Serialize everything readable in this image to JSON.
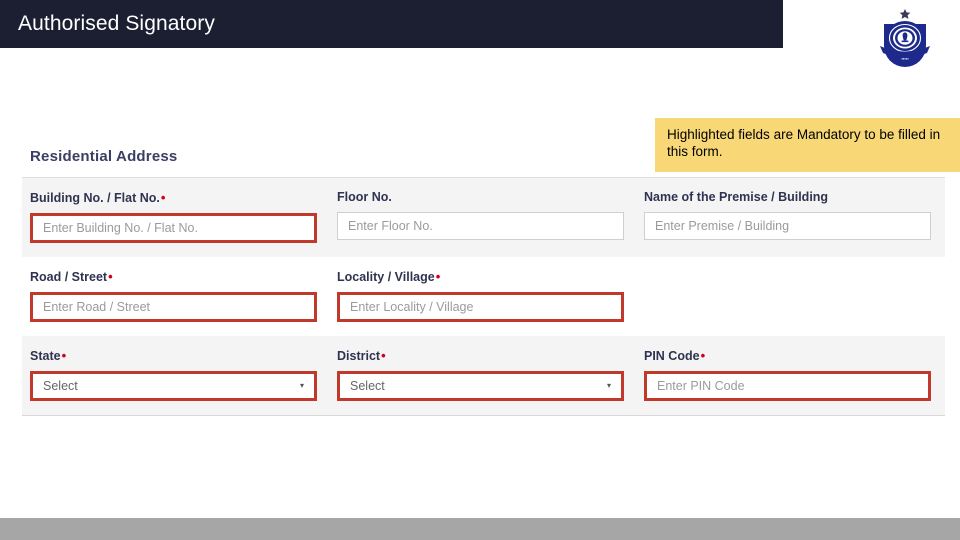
{
  "header": {
    "title": "Authorised Signatory",
    "emblem_label": "government-emblem",
    "background_color": "#1c1f31"
  },
  "callout": {
    "text": "Highlighted fields are Mandatory to be filled in this form.",
    "background_color": "#f8d777"
  },
  "form": {
    "section_title": "Residential Address",
    "required_marker": "•",
    "select_caret": "▾",
    "mandatory_border_color": "#c0392b",
    "optional_border_color": "#cfcfcf",
    "rows": [
      {
        "fields": [
          {
            "label": "Building No. / Flat No.",
            "required": true,
            "type": "text",
            "placeholder": "Enter Building No. / Flat No.",
            "value": ""
          },
          {
            "label": "Floor No.",
            "required": false,
            "type": "text",
            "placeholder": "Enter Floor No.",
            "value": ""
          },
          {
            "label": "Name of the Premise / Building",
            "required": false,
            "type": "text",
            "placeholder": "Enter Premise / Building",
            "value": ""
          }
        ]
      },
      {
        "fields": [
          {
            "label": "Road / Street",
            "required": true,
            "type": "text",
            "placeholder": "Enter Road / Street",
            "value": ""
          },
          {
            "label": "Locality / Village",
            "required": true,
            "type": "text",
            "placeholder": "Enter Locality / Village",
            "value": ""
          }
        ]
      },
      {
        "fields": [
          {
            "label": "State",
            "required": true,
            "type": "select",
            "placeholder": "Select",
            "value": "Select"
          },
          {
            "label": "District",
            "required": true,
            "type": "select",
            "placeholder": "Select",
            "value": "Select"
          },
          {
            "label": "PIN Code",
            "required": true,
            "type": "text",
            "placeholder": "Enter PIN Code",
            "value": ""
          }
        ]
      }
    ]
  },
  "footer": {
    "background_color": "#a6a6a6"
  }
}
